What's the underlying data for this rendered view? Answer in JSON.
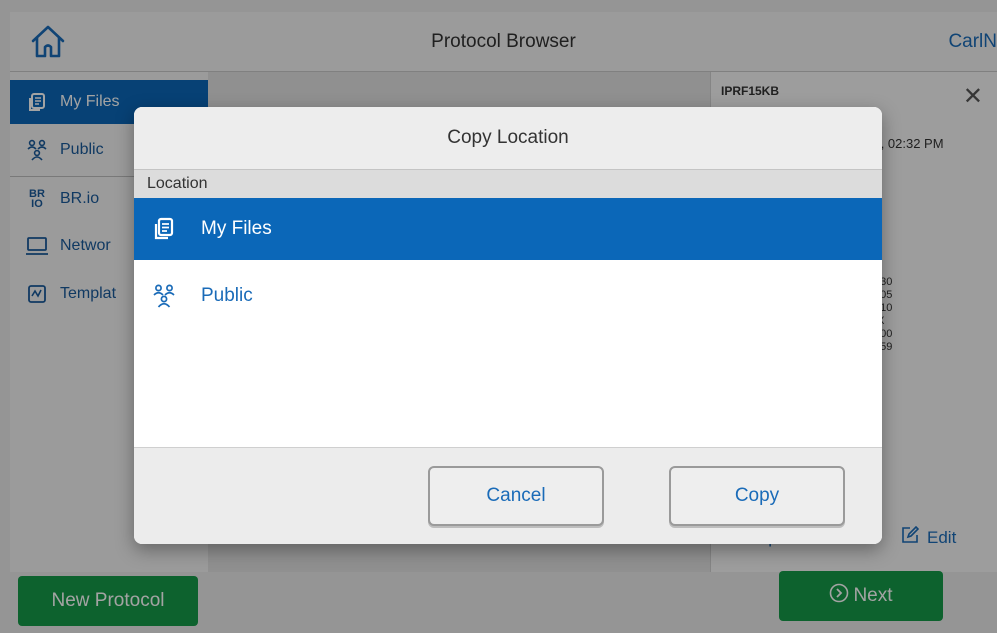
{
  "app": {
    "title": "Protocol Browser",
    "user": "CarlN"
  },
  "sidebar": {
    "items": [
      {
        "label": "My Files",
        "icon": "my-files-icon",
        "active": true
      },
      {
        "label": "Public",
        "icon": "public-icon"
      },
      {
        "label": "BR.io",
        "icon": "brio-icon"
      },
      {
        "label": "Networ",
        "icon": "network-icon"
      },
      {
        "label": "Templat",
        "icon": "template-icon"
      }
    ]
  },
  "detail": {
    "protocol_id": "IPRF15KB",
    "date": "022, 02:32 PM",
    "times": [
      "0:30",
      "0:05",
      "0:10",
      "9X",
      "5:00",
      "9:59"
    ],
    "options_label": "Options",
    "edit_label": "Edit"
  },
  "buttons": {
    "new_protocol": "New Protocol",
    "next": "Next"
  },
  "modal": {
    "title": "Copy Location",
    "section_label": "Location",
    "options": [
      {
        "label": "My Files",
        "icon": "my-files-icon",
        "selected": true
      },
      {
        "label": "Public",
        "icon": "public-icon",
        "selected": false
      }
    ],
    "cancel_label": "Cancel",
    "copy_label": "Copy"
  },
  "colors": {
    "accent": "#0b67b8",
    "link": "#1a6bb8",
    "primary_button": "#159a48"
  }
}
